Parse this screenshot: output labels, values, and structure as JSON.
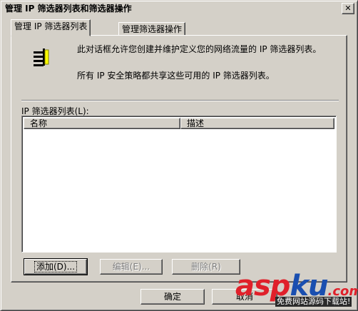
{
  "window": {
    "title": "管理 IP 筛选器列表和筛选器操作",
    "close_label": "✕"
  },
  "tabs": [
    {
      "label": "管理 IP 筛选器列表",
      "active": true
    },
    {
      "label": "管理筛选器操作",
      "active": false
    }
  ],
  "panel": {
    "icon": "filter-list-icon",
    "description_1": "此对话框允许您创建并维护定义您的网络流量的 IP 筛选器列表。",
    "description_2": "所有 IP 安全策略都共享这些可用的 IP 筛选器列表。",
    "list_label": "IP 筛选器列表(L):",
    "columns": [
      "名称",
      "描述"
    ],
    "rows": []
  },
  "buttons": {
    "add": "添加(D)...",
    "edit": "编辑(E)...",
    "remove": "删除(R)",
    "ok": "确定",
    "cancel": "取消"
  },
  "watermark": {
    "asp": "asp",
    "ku": "ku",
    "com": ".com",
    "sub": "免费网站源码下载站!"
  },
  "colors": {
    "face": "#d4d0c8",
    "shadow": "#808080",
    "highlight": "#ffffff",
    "dark": "#404040",
    "watermark_red": "#e0202a",
    "watermark_blue": "#1a4fb0"
  }
}
